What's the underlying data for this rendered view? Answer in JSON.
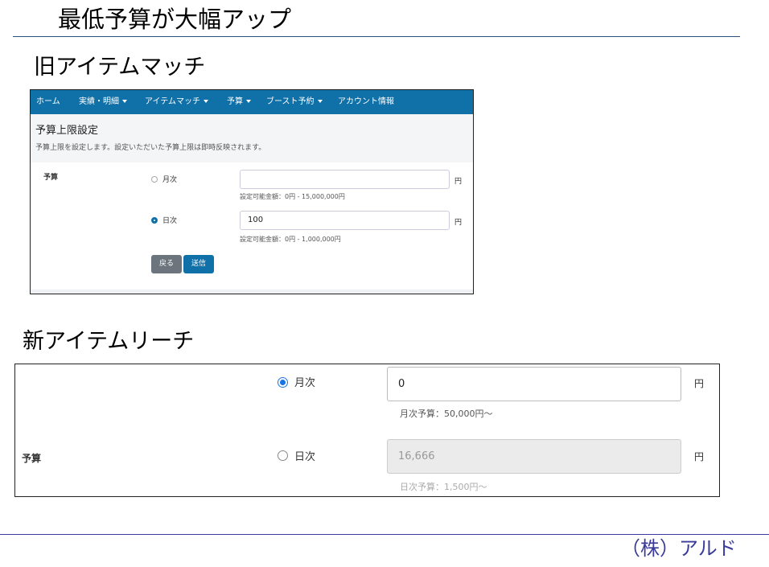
{
  "slide": {
    "title": "最低予算が大幅アップ",
    "old_section_title": "旧アイテムマッチ",
    "new_section_title": "新アイテムリーチ",
    "footer": "（株）アルド"
  },
  "old_ui": {
    "nav": [
      "ホーム",
      "実績・明細",
      "アイテムマッチ",
      "予算",
      "ブースト予約",
      "アカウント情報"
    ],
    "panel_title": "予算上限設定",
    "panel_desc": "予算上限を設定します。設定いただいた予算上限は即時反映されます。",
    "field_label": "予算",
    "monthly": {
      "label": "月次",
      "value": "",
      "unit": "円",
      "hint": "設定可能金額：0円 - 15,000,000円",
      "selected": false
    },
    "daily": {
      "label": "日次",
      "value": "100",
      "unit": "円",
      "hint": "設定可能金額：0円 - 1,000,000円",
      "selected": true
    },
    "back_button": "戻る",
    "submit_button": "送信"
  },
  "new_ui": {
    "field_label": "予算",
    "monthly": {
      "label": "月次",
      "value": "0",
      "unit": "円",
      "hint": "月次予算：50,000円～",
      "selected": true
    },
    "daily": {
      "label": "日次",
      "value": "16,666",
      "unit": "円",
      "hint": "日次予算：1,500円～",
      "selected": false
    }
  },
  "colors": {
    "nav_bar": "#1070a8",
    "primary_button": "#1070a8",
    "secondary_button": "#6c757d",
    "radio_selected_new": "#1a73e8",
    "footer_text": "#3a3a9a"
  }
}
